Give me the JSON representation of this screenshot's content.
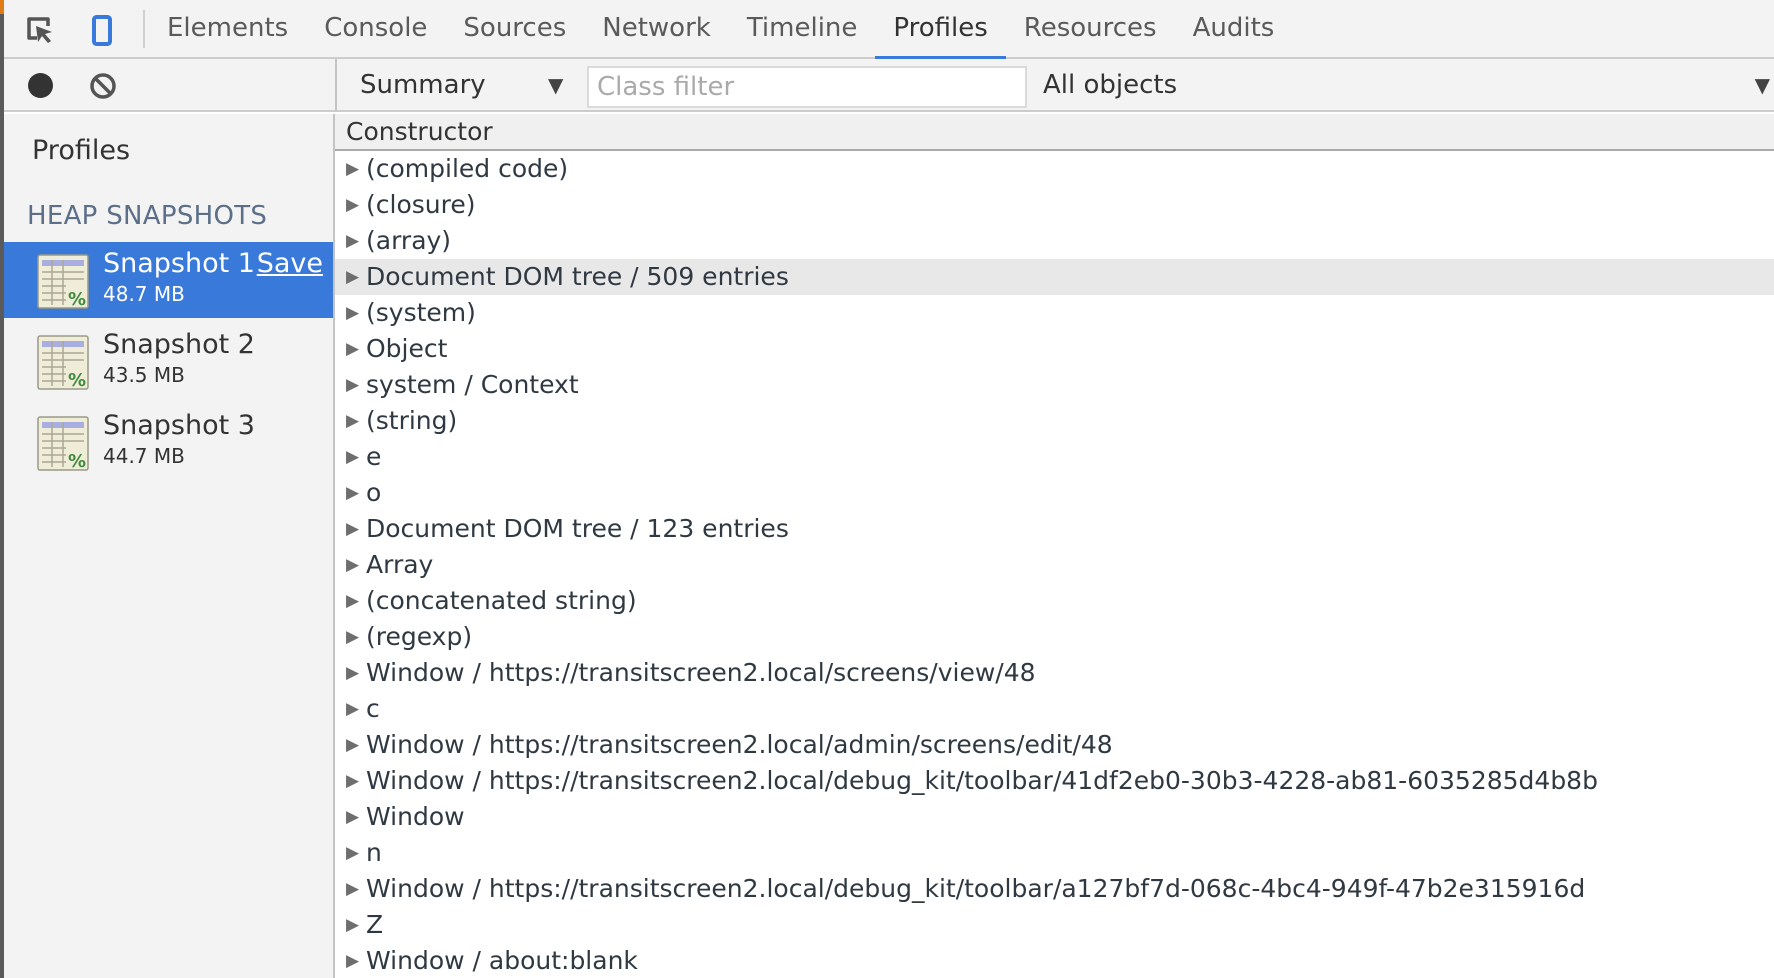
{
  "tabbar": {
    "icons": [
      "inspect-element-icon",
      "device-mode-icon"
    ],
    "tabs": [
      {
        "label": "Elements",
        "active": false
      },
      {
        "label": "Console",
        "active": false
      },
      {
        "label": "Sources",
        "active": false
      },
      {
        "label": "Network",
        "active": false
      },
      {
        "label": "Timeline",
        "active": false
      },
      {
        "label": "Profiles",
        "active": true
      },
      {
        "label": "Resources",
        "active": false
      },
      {
        "label": "Audits",
        "active": false
      }
    ]
  },
  "toolbar": {
    "record_icon": "record-icon",
    "clear_icon": "clear-icon",
    "view_select": "Summary",
    "class_filter_placeholder": "Class filter",
    "class_filter_value": "",
    "objects_select": "All objects"
  },
  "sidebar": {
    "title": "Profiles",
    "section": "HEAP SNAPSHOTS",
    "snapshots": [
      {
        "name": "Snapshot 1",
        "size": "48.7 MB",
        "selected": true,
        "save_label": "Save"
      },
      {
        "name": "Snapshot 2",
        "size": "43.5 MB",
        "selected": false
      },
      {
        "name": "Snapshot 3",
        "size": "44.7 MB",
        "selected": false
      }
    ]
  },
  "grid": {
    "header": "Constructor",
    "rows": [
      {
        "label": "(compiled code)"
      },
      {
        "label": "(closure)"
      },
      {
        "label": "(array)"
      },
      {
        "label": "Document DOM tree / 509 entries",
        "highlighted": true
      },
      {
        "label": "(system)"
      },
      {
        "label": "Object"
      },
      {
        "label": "system / Context"
      },
      {
        "label": "(string)"
      },
      {
        "label": "e"
      },
      {
        "label": "o"
      },
      {
        "label": "Document DOM tree / 123 entries"
      },
      {
        "label": "Array"
      },
      {
        "label": "(concatenated string)"
      },
      {
        "label": "(regexp)"
      },
      {
        "label": "Window / https://transitscreen2.local/screens/view/48"
      },
      {
        "label": "c"
      },
      {
        "label": "Window / https://transitscreen2.local/admin/screens/edit/48"
      },
      {
        "label": "Window / https://transitscreen2.local/debug_kit/toolbar/41df2eb0-30b3-4228-ab81-6035285d4b8b"
      },
      {
        "label": "Window"
      },
      {
        "label": "n"
      },
      {
        "label": "Window / https://transitscreen2.local/debug_kit/toolbar/a127bf7d-068c-4bc4-949f-47b2e315916d"
      },
      {
        "label": "Z"
      },
      {
        "label": "Window / about:blank"
      }
    ]
  },
  "colors": {
    "accent": "#3879d9",
    "panel_bg": "#f3f3f3",
    "section_label": "#5b6f88",
    "row_highlight": "#e8e8e8"
  }
}
